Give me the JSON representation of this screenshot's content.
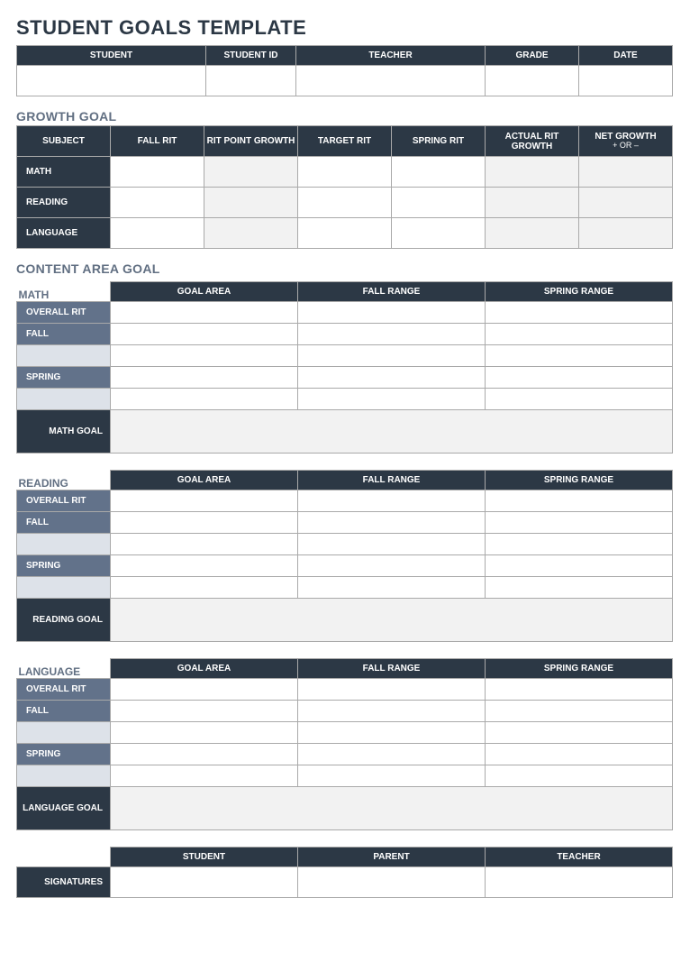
{
  "title": "STUDENT GOALS TEMPLATE",
  "info": {
    "headers": [
      "STUDENT",
      "STUDENT ID",
      "TEACHER",
      "GRADE",
      "DATE"
    ]
  },
  "growth": {
    "title": "GROWTH GOAL",
    "headers": [
      "SUBJECT",
      "FALL RIT",
      "RIT POINT GROWTH",
      "TARGET RIT",
      "SPRING RIT",
      "ACTUAL RIT GROWTH",
      "NET GROWTH"
    ],
    "net_sub": "+ OR –",
    "rows": [
      "MATH",
      "READING",
      "LANGUAGE"
    ]
  },
  "content": {
    "title": "CONTENT AREA GOAL",
    "col_headers": [
      "GOAL AREA",
      "FALL RANGE",
      "SPRING RANGE"
    ],
    "row_labels": {
      "overall": "OVERALL RIT",
      "fall": "FALL",
      "spring": "SPRING"
    },
    "subjects": [
      {
        "name": "MATH",
        "goal_label": "MATH GOAL"
      },
      {
        "name": "READING",
        "goal_label": "READING GOAL"
      },
      {
        "name": "LANGUAGE",
        "goal_label": "LANGUAGE GOAL"
      }
    ]
  },
  "signatures": {
    "row_label": "SIGNATURES",
    "headers": [
      "STUDENT",
      "PARENT",
      "TEACHER"
    ]
  }
}
